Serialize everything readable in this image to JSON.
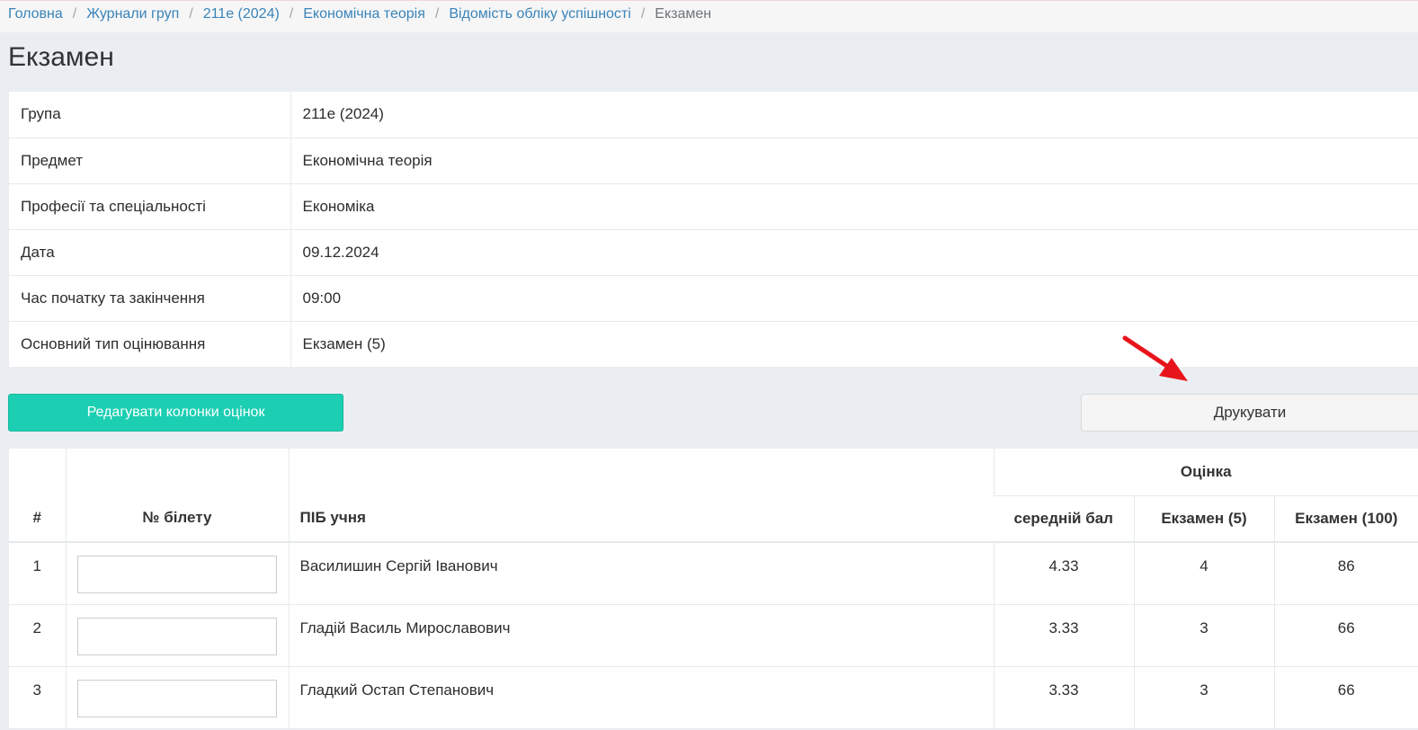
{
  "breadcrumb": [
    "Головна",
    "Журнали груп",
    "211е (2024)",
    "Економічна теорія",
    "Відомість обліку успішності"
  ],
  "breadcrumb_active": "Екзамен",
  "page_title": "Екзамен",
  "info": [
    {
      "label": "Група",
      "value": "211е (2024)"
    },
    {
      "label": "Предмет",
      "value": "Економічна теорія"
    },
    {
      "label": "Професії та спеціальності",
      "value": "Економіка"
    },
    {
      "label": "Дата",
      "value": "09.12.2024"
    },
    {
      "label": "Час початку та закінчення",
      "value": "09:00"
    },
    {
      "label": "Основний тип оцінювання",
      "value": "Екзамен (5)"
    }
  ],
  "buttons": {
    "edit_columns": "Редагувати колонки оцінок",
    "print": "Друкувати"
  },
  "table": {
    "col_num": "#",
    "col_ticket": "№ білету",
    "col_name": "ПІБ учня",
    "group_grade": "Оцінка",
    "col_avg": "середній бал",
    "col_exam5": "Екзамен (5)",
    "col_exam100": "Екзамен (100)",
    "rows": [
      {
        "num": "1",
        "ticket": "",
        "name": "Василишин Сергій Іванович",
        "avg": "4.33",
        "exam5": "4",
        "exam100": "86"
      },
      {
        "num": "2",
        "ticket": "",
        "name": "Гладій Василь Мирославович",
        "avg": "3.33",
        "exam5": "3",
        "exam100": "66"
      },
      {
        "num": "3",
        "ticket": "",
        "name": "Гладкий Остап Степанович",
        "avg": "3.33",
        "exam5": "3",
        "exam100": "66"
      }
    ]
  },
  "colors": {
    "accent_button": "#1ccfb2",
    "link": "#3a84b8",
    "annotation_arrow": "#e8141b"
  },
  "icons": [
    "red-arrow-annotation-icon"
  ]
}
